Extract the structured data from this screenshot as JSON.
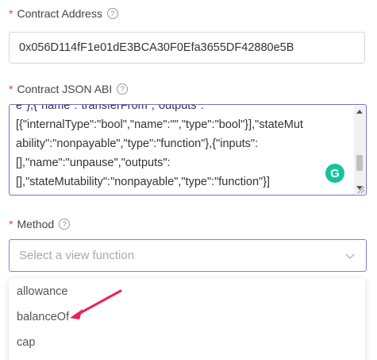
{
  "contract_address": {
    "label": "Contract Address",
    "required_mark": "*",
    "help_glyph": "?",
    "value": "0x056D114fF1e01dE3BCA30F0Efa3655DF42880e5B"
  },
  "contract_abi": {
    "label": "Contract JSON ABI",
    "required_mark": "*",
    "help_glyph": "?",
    "value": "e\"},{\"name\":\"transferFrom\",\"outputs\":\n[{\"internalType\":\"bool\",\"name\":\"\",\"type\":\"bool\"}],\"stateMut\nability\":\"nonpayable\",\"type\":\"function\"},{\"inputs\":\n[],\"name\":\"unpause\",\"outputs\":\n[],\"stateMutability\":\"nonpayable\",\"type\":\"function\"}]",
    "grammarly_glyph": "G"
  },
  "method": {
    "label": "Method",
    "required_mark": "*",
    "help_glyph": "?",
    "placeholder": "Select a view function",
    "options": [
      "allowance",
      "balanceOf",
      "cap"
    ]
  },
  "colors": {
    "required": "#e0443c",
    "focus_border": "#7a6ad0",
    "arrow": "#e8225a",
    "grammarly": "#15c39a"
  }
}
